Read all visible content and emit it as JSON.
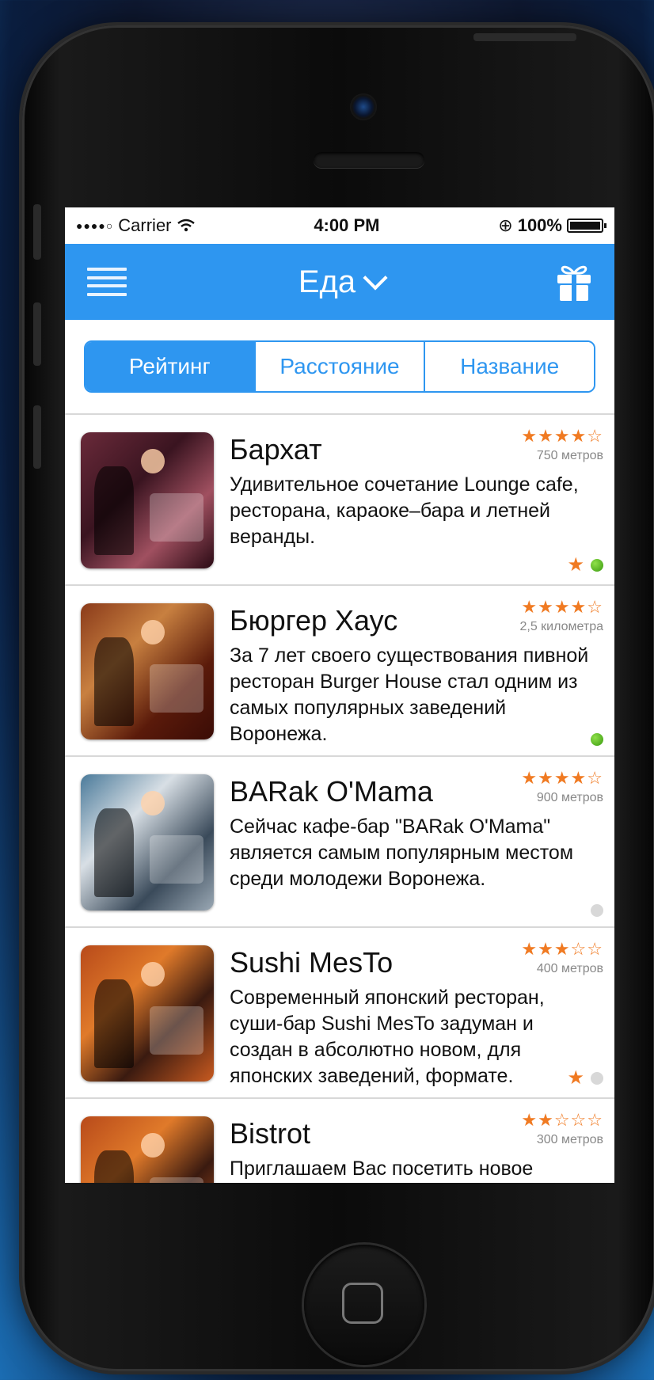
{
  "status_bar": {
    "signal_dots": "●●●●○",
    "carrier": "Carrier",
    "wifi": "wifi-icon",
    "time": "4:00 PM",
    "rotation_lock": "⊕",
    "battery_text": "100%"
  },
  "navbar": {
    "title": "Еда",
    "menu_icon": "hamburger-menu-icon",
    "gift_icon": "gift-icon",
    "color": "#2e96f0"
  },
  "segments": [
    {
      "label": "Рейтинг",
      "active": true
    },
    {
      "label": "Расстояние",
      "active": false
    },
    {
      "label": "Название",
      "active": false
    }
  ],
  "places": [
    {
      "name": "Бархат",
      "stars": "★★★★☆",
      "distance": "750 метров",
      "description": "Удивительное сочетание Lounge cafe, ресторана, караоке–бара и летней веранды.",
      "favorite": true,
      "status": "green"
    },
    {
      "name": "Бюргер Хаус",
      "stars": "★★★★☆",
      "distance": "2,5 километра",
      "description": "За 7 лет своего существования пивной ресторан Burger House стал одним из самых популярных заведений Воронежа.",
      "favorite": false,
      "status": "green"
    },
    {
      "name": "BARak O'Mama",
      "stars": "★★★★☆",
      "distance": "900 метров",
      "description": "Сейчас кафе-бар \"BARak O'Mama\" является самым популярным местом среди молодежи Воронежа.",
      "favorite": false,
      "status": "grey"
    },
    {
      "name": "Sushi MesTo",
      "stars": "★★★☆☆",
      "distance": "400 метров",
      "description": "Современный японский ресторан, суши-бар Sushi MesTo задуман и создан в абсолютно новом, для японских заведений, формате.",
      "favorite": true,
      "status": "grey"
    },
    {
      "name": "Bistrot",
      "stars": "★★☆☆☆",
      "distance": "300 метров",
      "description": "Приглашаем Вас посетить новое",
      "favorite": false,
      "status": ""
    }
  ]
}
